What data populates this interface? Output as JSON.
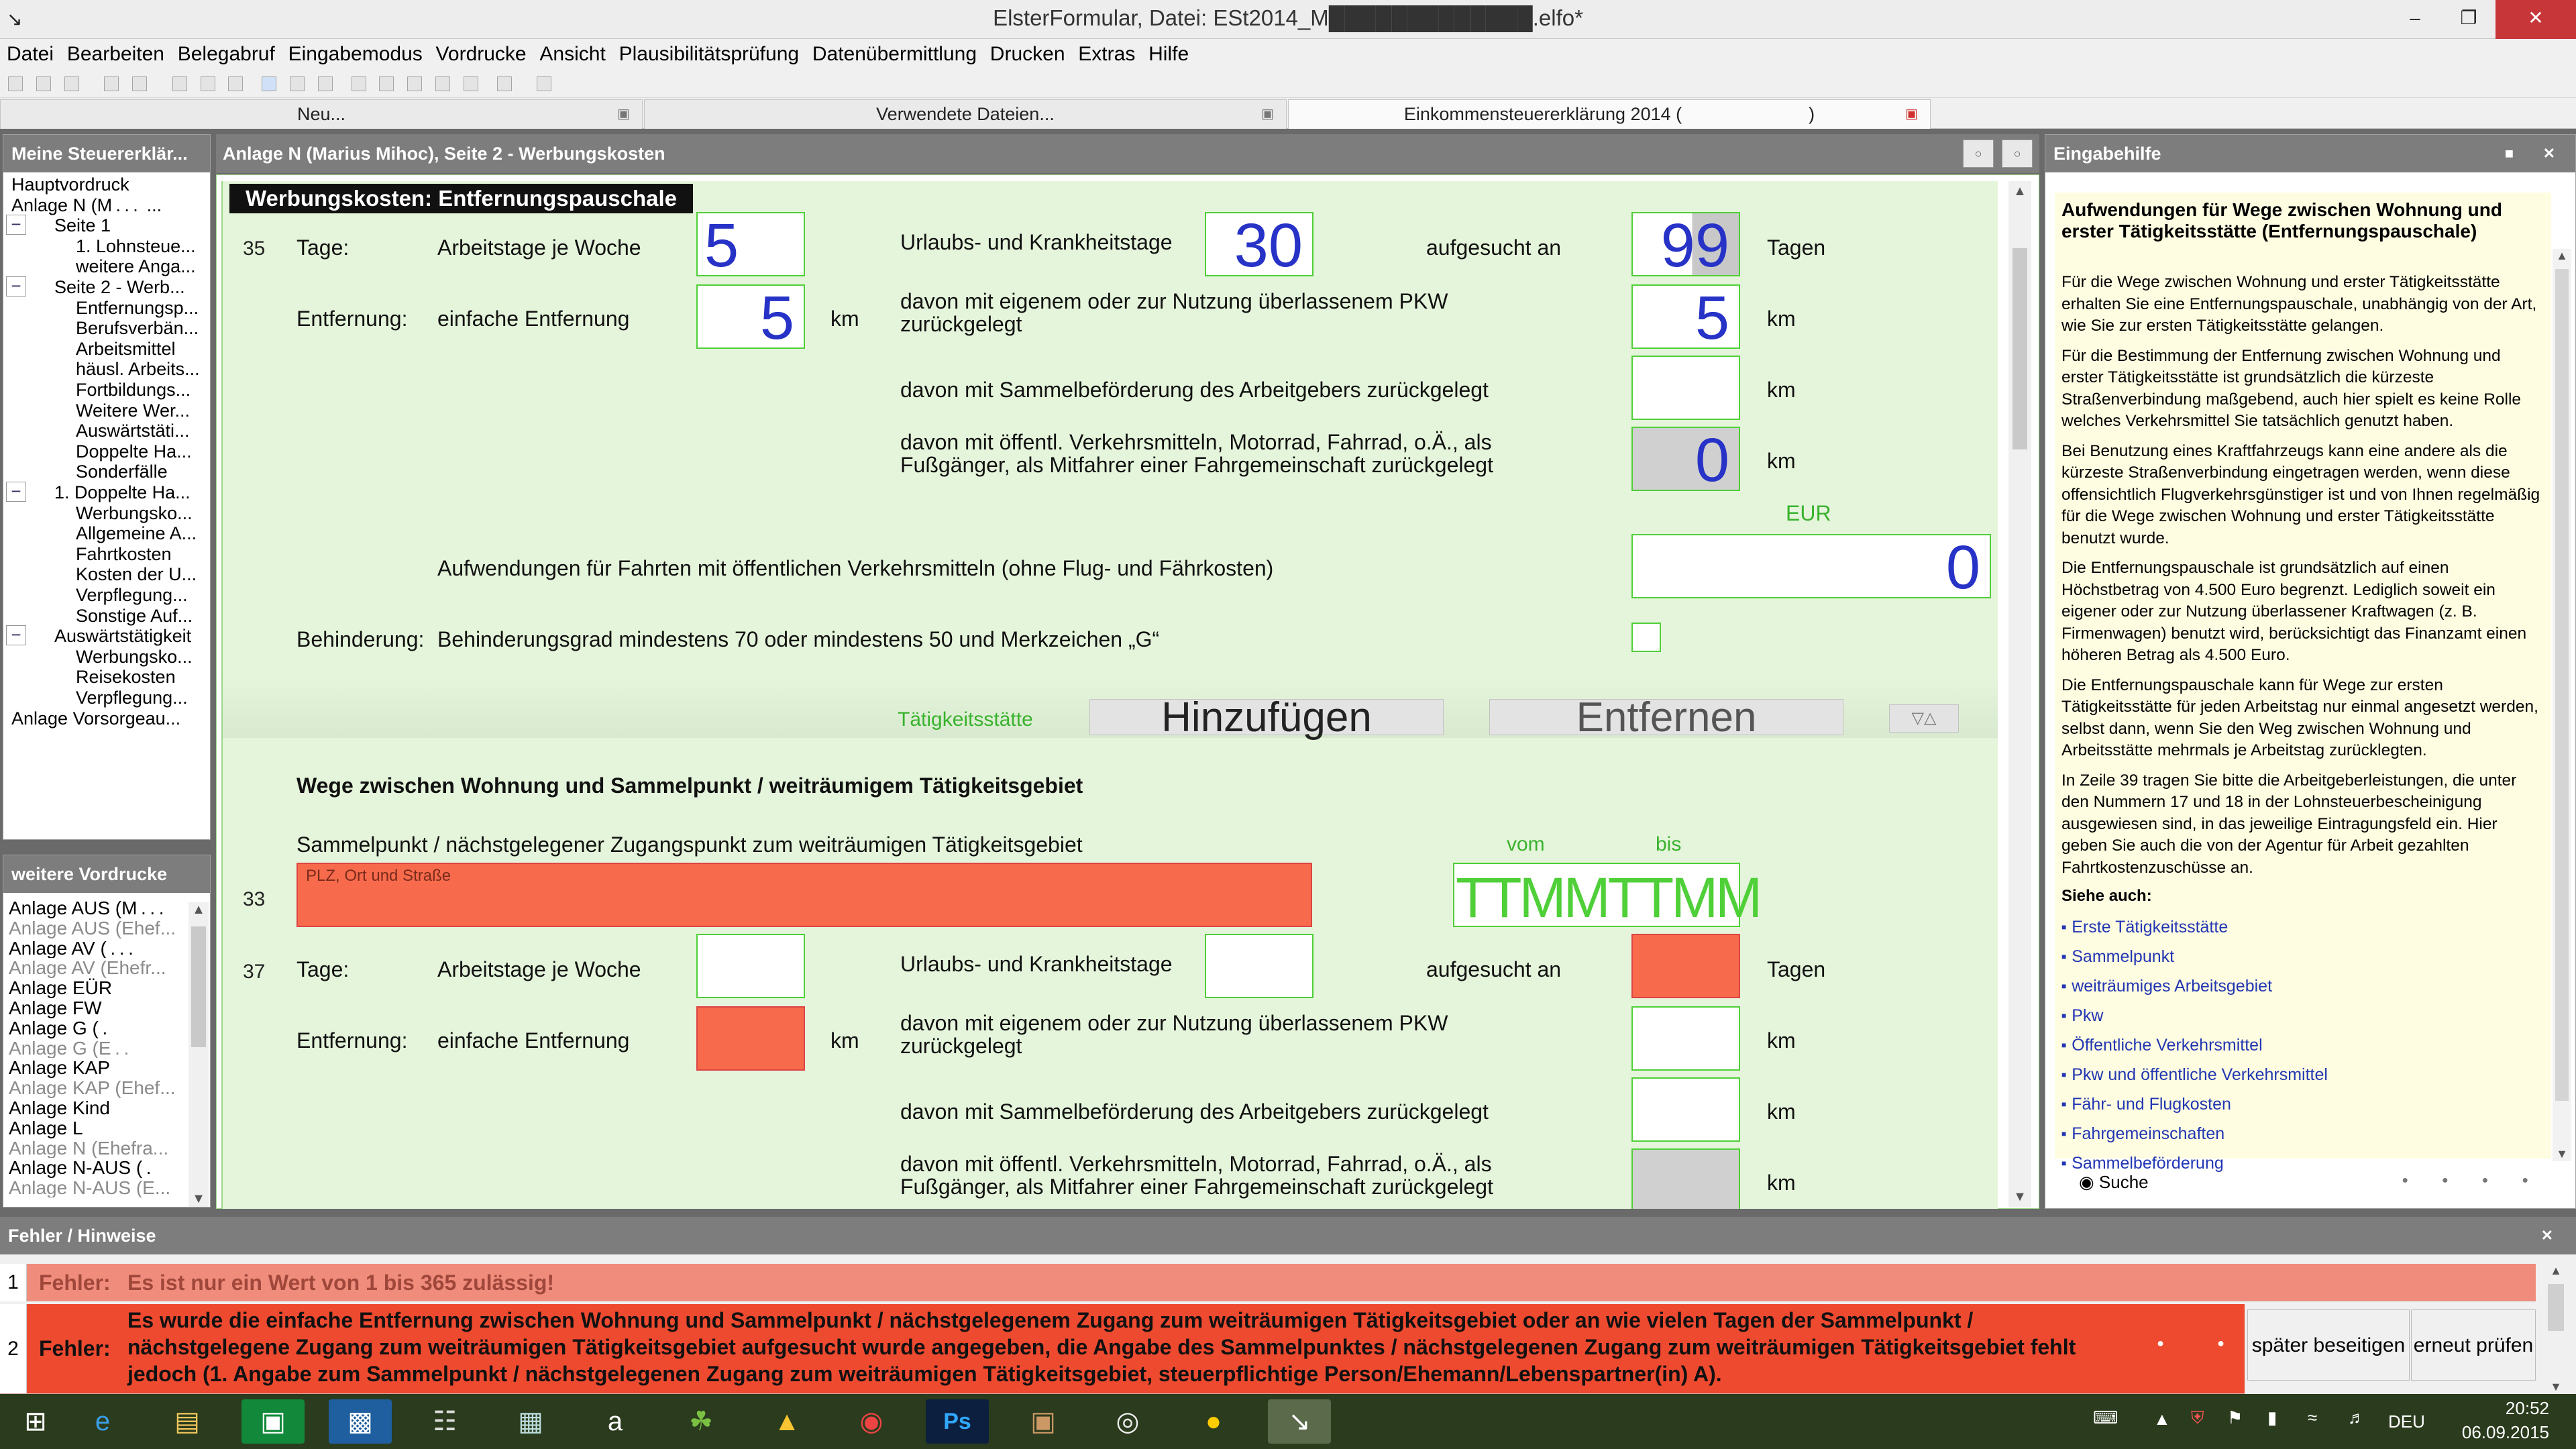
{
  "window": {
    "title": "ElsterFormular, Datei: ESt2014_M█████████████.elfo*",
    "minimize": "–",
    "maximize": "❐",
    "close": "✕"
  },
  "menu": [
    "Datei",
    "Bearbeiten",
    "Belegabruf",
    "Eingabemodus",
    "Vordrucke",
    "Ansicht",
    "Plausibilitätsprüfung",
    "Datenübermittlung",
    "Drucken",
    "Extras",
    "Hilfe"
  ],
  "tabs": {
    "tab1": "Neu...",
    "tab2": "Verwendete Dateien...",
    "tab3": "Einkommensteuererklärung 2014 (       )",
    "close_glyph": "▣"
  },
  "left": {
    "header": "Meine Steuererklär...",
    "tree": [
      {
        "label": "Hauptvordruck",
        "indent": 0,
        "toggle": ""
      },
      {
        "label": "Anlage N (M . . .  ...",
        "indent": 0,
        "toggle": ""
      },
      {
        "label": "Seite 1",
        "indent": 1,
        "toggle": "−"
      },
      {
        "label": "1. Lohnsteue...",
        "indent": 2,
        "toggle": ""
      },
      {
        "label": "weitere Anga...",
        "indent": 2,
        "toggle": ""
      },
      {
        "label": "Seite 2 - Werb...",
        "indent": 1,
        "toggle": "−"
      },
      {
        "label": "Entfernungsp...",
        "indent": 2,
        "toggle": ""
      },
      {
        "label": "Berufsverbän...",
        "indent": 2,
        "toggle": ""
      },
      {
        "label": "Arbeitsmittel",
        "indent": 2,
        "toggle": ""
      },
      {
        "label": "häusl. Arbeits...",
        "indent": 2,
        "toggle": ""
      },
      {
        "label": "Fortbildungs...",
        "indent": 2,
        "toggle": ""
      },
      {
        "label": "Weitere Wer...",
        "indent": 2,
        "toggle": ""
      },
      {
        "label": "Auswärtstäti...",
        "indent": 2,
        "toggle": ""
      },
      {
        "label": "Doppelte Ha...",
        "indent": 2,
        "toggle": ""
      },
      {
        "label": "Sonderfälle",
        "indent": 2,
        "toggle": ""
      },
      {
        "label": "1. Doppelte Ha...",
        "indent": 1,
        "toggle": "−"
      },
      {
        "label": "Werbungsko...",
        "indent": 2,
        "toggle": ""
      },
      {
        "label": "Allgemeine A...",
        "indent": 2,
        "toggle": ""
      },
      {
        "label": "Fahrtkosten",
        "indent": 2,
        "toggle": ""
      },
      {
        "label": "Kosten der U...",
        "indent": 2,
        "toggle": ""
      },
      {
        "label": "Verpflegung...",
        "indent": 2,
        "toggle": ""
      },
      {
        "label": "Sonstige Auf...",
        "indent": 2,
        "toggle": ""
      },
      {
        "label": "Auswärtstätigkeit",
        "indent": 1,
        "toggle": "−"
      },
      {
        "label": "Werbungsko...",
        "indent": 2,
        "toggle": ""
      },
      {
        "label": "Reisekosten",
        "indent": 2,
        "toggle": ""
      },
      {
        "label": "Verpflegung...",
        "indent": 2,
        "toggle": ""
      },
      {
        "label": "Anlage Vorsorgeau...",
        "indent": 0,
        "toggle": ""
      }
    ],
    "forms_header": "weitere Vordrucke",
    "forms": [
      {
        "label": "Anlage AUS (M . . .",
        "muted": false
      },
      {
        "label": "Anlage AUS (Ehef...",
        "muted": true
      },
      {
        "label": "Anlage AV ( . . .",
        "muted": false
      },
      {
        "label": "Anlage AV (Ehefr...",
        "muted": true
      },
      {
        "label": "Anlage EÜR",
        "muted": false
      },
      {
        "label": "Anlage FW",
        "muted": false
      },
      {
        "label": "Anlage G ( .",
        "muted": false
      },
      {
        "label": "Anlage G (E . .",
        "muted": true
      },
      {
        "label": "Anlage KAP",
        "muted": false
      },
      {
        "label": "Anlage KAP (Ehef...",
        "muted": true
      },
      {
        "label": "Anlage Kind",
        "muted": false
      },
      {
        "label": "Anlage L",
        "muted": false
      },
      {
        "label": "Anlage N (Ehefra...",
        "muted": true
      },
      {
        "label": "Anlage N-AUS ( .",
        "muted": false
      },
      {
        "label": "Anlage N-AUS (E...",
        "muted": true
      }
    ]
  },
  "form": {
    "header": "Anlage N (Marius Mihoc), Seite 2 - Werbungskosten",
    "section": "Werbungskosten: Entfernungspauschale",
    "row35": "35",
    "tage": "Tage:",
    "arbeitstage": "Arbeitstage je Woche",
    "arbeitstage_val": "5",
    "urlaub": "Urlaubs- und Krankheitstage",
    "urlaub_val": "30",
    "aufgesucht": "aufgesucht an",
    "aufgesucht_val": "99",
    "tagen": "Tagen",
    "entfernung": "Entfernung:",
    "einfache": "einfache Entfernung",
    "einfache_val": "5",
    "km": "km",
    "pkw": "davon mit eigenem oder zur Nutzung überlassenem PKW zurückgelegt",
    "pkw_val": "5",
    "sammel": "davon mit Sammelbeförderung des Arbeitgebers zurückgelegt",
    "oeffentl": "davon mit öffentl. Verkehrsmitteln, Motorrad, Fahrrad, o.Ä., als Fußgänger, als Mitfahrer einer Fahrgemeinschaft zurückgelegt",
    "oeffentl_val": "0",
    "eur": "EUR",
    "aufwendungen": "Aufwendungen für Fahrten mit öffentlichen Verkehrsmitteln (ohne Flug- und Fährkosten)",
    "aufwendungen_val": "0",
    "behinderung": "Behinderung:",
    "behinderung_text": "Behinderungsgrad mindestens 70 oder mindestens 50 und Merkzeichen „G“",
    "taetigkeitsstaette": "Tätigkeitsstätte",
    "hinzufuegen": "Hinzufügen",
    "entfernen": "Entfernen",
    "section2": "Wege zwischen Wohnung und Sammelpunkt / weiträumigem Tätigkeitsgebiet",
    "sammelpunkt": "Sammelpunkt / nächstgelegener Zugangspunkt zum weiträumigen Tätigkeitsgebiet",
    "row33": "33",
    "plz_placeholder": "PLZ, Ort und Straße",
    "vom": "vom",
    "bis": "bis",
    "date_mask": "TTMMTTMM",
    "row37": "37"
  },
  "help": {
    "header": "Eingabehilfe",
    "title": "Aufwendungen für Wege zwischen Wohnung und erster Tätigkeitsstätte (Entfernungspauschale)",
    "paragraphs": [
      "Für die Wege zwischen Wohnung und erster Tätigkeitsstätte erhalten Sie eine Entfernungspauschale, unabhängig von der Art, wie Sie zur ersten Tätigkeitsstätte gelangen.",
      "Für die Bestimmung der Entfernung zwischen Wohnung und erster Tätigkeitsstätte ist grundsätzlich die kürzeste Straßenverbindung maßgebend, auch hier spielt es keine Rolle welches Verkehrsmittel Sie tatsächlich genutzt haben.",
      "Bei Benutzung eines Kraftfahrzeugs kann eine andere als die kürzeste Straßenverbindung eingetragen werden, wenn diese offensichtlich Flugverkehrsgünstiger ist und von Ihnen regelmäßig für die Wege zwischen Wohnung und erster Tätigkeitsstätte benutzt wurde.",
      "Die Entfernungspauschale ist grundsätzlich auf einen Höchstbetrag von 4.500 Euro begrenzt. Lediglich soweit ein eigener oder zur Nutzung überlassener Kraftwagen (z. B. Firmenwagen) benutzt wird, berücksichtigt das Finanzamt einen höheren Betrag als 4.500 Euro.",
      "Die Entfernungspauschale kann für Wege zur ersten Tätigkeitsstätte für jeden Arbeitstag nur einmal angesetzt werden, selbst dann, wenn Sie den Weg zwischen Wohnung und Arbeitsstätte mehrmals je Arbeitstag zurücklegten.",
      "In Zeile 39 tragen Sie bitte die Arbeitgeberleistungen, die unter den Nummern 17 und 18 in der Lohnsteuerbescheinigung ausgewiesen sind, in das jeweilige Eintragungsfeld ein. Hier geben Sie auch die von der Agentur für Arbeit gezahlten Fahrtkostenzuschüsse an."
    ],
    "see_also": "Siehe auch:",
    "links": [
      "Erste Tätigkeitsstätte",
      "Sammelpunkt",
      "weiträumiges Arbeitsgebiet",
      "Pkw",
      "Öffentliche Verkehrsmittel",
      "Pkw und öffentliche Verkehrsmittel",
      "Fähr- und Flugkosten",
      "Fahrgemeinschaften",
      "Sammelbeförderung"
    ],
    "search": "Suche"
  },
  "errors": {
    "header": "Fehler / Hinweise",
    "rows": [
      {
        "num": "1",
        "label": "Fehler:",
        "msg": "Es ist nur ein Wert von 1 bis 365 zulässig!"
      },
      {
        "num": "2",
        "label": "Fehler:",
        "msg": "Es wurde die einfache Entfernung zwischen Wohnung und Sammelpunkt / nächstgelegenem Zugang zum weiträumigen Tätigkeitsgebiet oder an wie vielen Tagen der Sammelpunkt / nächstgelegene Zugang zum weiträumigen Tätigkeitsgebiet aufgesucht wurde angegeben, die Angabe des Sammelpunktes / nächstgelegenen Zugang zum weiträumigen Tätigkeitsgebiet fehlt jedoch (1. Angabe zum Sammelpunkt / nächstgelegenen Zugang zum weiträumigen Tätigkeitsgebiet, steuerpflichtige Person/Ehemann/Lebenspartner(in) A)."
      }
    ],
    "later": "später beseitigen",
    "recheck": "erneut prüfen"
  },
  "taskbar": {
    "lang": "DEU",
    "time": "20:52",
    "date": "06.09.2015"
  }
}
